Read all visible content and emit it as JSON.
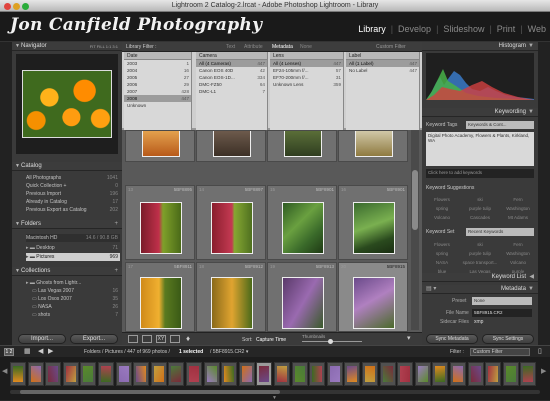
{
  "window": {
    "title": "Lightroom 2 Catalog-2.lrcat - Adobe Photoshop Lightroom - Library"
  },
  "identity_plate": "Jon Canfield Photography",
  "modules": [
    "Library",
    "Develop",
    "Slideshow",
    "Print",
    "Web"
  ],
  "left_panel": {
    "navigator": {
      "label": "Navigator",
      "zoom": "FIT  FILL  1:1  3:1"
    },
    "catalog": {
      "label": "Catalog",
      "items": [
        {
          "label": "All Photographs",
          "count": "1041"
        },
        {
          "label": "Quick Collection +",
          "count": "0"
        },
        {
          "label": "Previous Import",
          "count": "196"
        },
        {
          "label": "Already in Catalog",
          "count": "17"
        },
        {
          "label": "Previous Export as Catalog",
          "count": "202"
        }
      ]
    },
    "folders": {
      "label": "Folders",
      "volume": "Macintosh HD",
      "volume_info": "14.6 / 90.8 GB",
      "items": [
        {
          "label": "Desktop",
          "count": "71"
        },
        {
          "label": "Pictures",
          "count": "969"
        }
      ]
    },
    "collections": {
      "label": "Collections",
      "items": [
        {
          "label": "Ghosts from Lightr..."
        },
        {
          "label": "Las Vegas 2007",
          "count": "16"
        },
        {
          "label": "Los Osos 2007",
          "count": "35"
        },
        {
          "label": "NASA",
          "count": "26"
        },
        {
          "label": "shots",
          "count": "7"
        }
      ]
    },
    "import_label": "Import...",
    "export_label": "Export..."
  },
  "filter_bar": {
    "label": "Library Filter :",
    "tabs": [
      "Text",
      "Attribute",
      "Metadata",
      "None"
    ],
    "active_tab": "Metadata",
    "preset": "Custom Filter"
  },
  "metadata_columns": [
    {
      "header": "Date",
      "items": [
        {
          "label": "2003",
          "count": "1"
        },
        {
          "label": "2004",
          "count": "16"
        },
        {
          "label": "2005",
          "count": "27"
        },
        {
          "label": "2006",
          "count": "29"
        },
        {
          "label": "2007",
          "count": "428"
        },
        {
          "label": "2008",
          "count": "447"
        },
        {
          "label": "Unknown",
          "count": ""
        }
      ],
      "selected": 5
    },
    {
      "header": "Camera",
      "items": [
        {
          "label": "All (4 Cameras)",
          "count": "447"
        },
        {
          "label": "Canon EOS 40D",
          "count": "42"
        },
        {
          "label": "Canon EOS-1D...",
          "count": "334"
        },
        {
          "label": "DMC-FZ50",
          "count": "64"
        },
        {
          "label": "DMC-L1",
          "count": "7"
        }
      ],
      "selected": 0
    },
    {
      "header": "Lens",
      "items": [
        {
          "label": "All (4 Lenses)",
          "count": "447"
        },
        {
          "label": "EF24-105mm f/...",
          "count": "57"
        },
        {
          "label": "EF70-200mm f/...",
          "count": "31"
        },
        {
          "label": "Unknown Lens",
          "count": "359"
        }
      ],
      "selected": 0
    },
    {
      "header": "Label",
      "items": [
        {
          "label": "All (1 Label)",
          "count": "447"
        },
        {
          "label": "No Label",
          "count": "447"
        }
      ],
      "selected": 0
    }
  ],
  "grid_cells": [
    {
      "num": "",
      "file": "",
      "dims": ""
    },
    {
      "num": "",
      "file": "",
      "dims": ""
    },
    {
      "num": "",
      "file": "",
      "dims": ""
    },
    {
      "num": "",
      "file": "",
      "dims": ""
    },
    {
      "num": "13",
      "file": "5BF8895",
      "dims": ""
    },
    {
      "num": "14",
      "file": "5BF8897",
      "dims": ""
    },
    {
      "num": "15",
      "file": "5BF8901",
      "dims": ""
    },
    {
      "num": "16",
      "file": "5BF8901",
      "dims": ""
    },
    {
      "num": "17",
      "file": "5BF8911",
      "dims": ""
    },
    {
      "num": "18",
      "file": "5BF8912",
      "dims": ""
    },
    {
      "num": "19",
      "file": "5BF8913",
      "dims": ""
    },
    {
      "num": "20",
      "file": "5BF8915",
      "dims": ""
    }
  ],
  "toolbar": {
    "sort_label": "Sort:",
    "sort_value": "Capture Time",
    "thumbnails_label": "Thumbnails"
  },
  "right_panel": {
    "histogram": {
      "label": "Histogram"
    },
    "keywording": {
      "label": "Keywording",
      "keyword_tags_label": "Keyword Tags",
      "keyword_tags_value": "Keywords & Cont...",
      "keywords_text": "Digital Photo Academy, Flowers & Plants, Kirkland, WA",
      "add_placeholder": "Click here to add keywords",
      "suggestions_label": "Keyword Suggestions",
      "suggestions": [
        "Flowers",
        "ski",
        "Fern",
        "spring",
        "purple tulip",
        "Washington",
        "Volcano",
        "Cascades",
        "Mt Adams"
      ],
      "keyword_set_label": "Keyword Set",
      "keyword_set_value": "Recent Keywords",
      "set_keywords": [
        "Flowers",
        "ski",
        "Fern",
        "spring",
        "purple tulip",
        "Washington",
        "NASA",
        "space transport...",
        "Volcano",
        "blue",
        "Las Vegas",
        "purple"
      ]
    },
    "keyword_list": {
      "label": "Keyword List"
    },
    "metadata": {
      "label": "Metadata",
      "preset_label": "Preset",
      "preset_value": "None",
      "file_name_label": "File Name",
      "file_name_value": "5BF8915.CR2",
      "sidecar_label": "Sidecar Files",
      "sidecar_value": "xmp"
    },
    "sync_meta_label": "Sync Metadata",
    "sync_settings_label": "Sync Settings"
  },
  "filmstrip_bar": {
    "pages": "1  2",
    "path": "Folders / Pictures / 447 of 969 photos /",
    "selected": "1 selected",
    "file": "/ 5BF8915.CR2 ▾",
    "filter_label": "Filter :",
    "filter_value": "Custom Filter"
  }
}
